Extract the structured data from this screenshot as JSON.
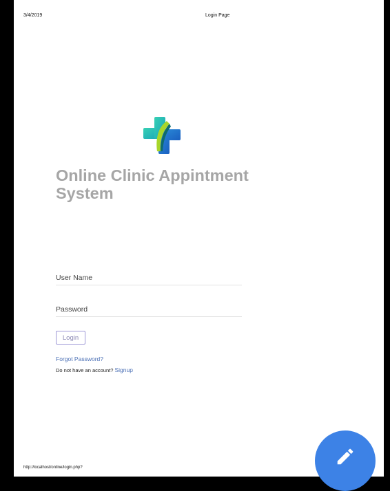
{
  "print_header": {
    "date": "3/4/2019",
    "title": "Login Page"
  },
  "app": {
    "title": "Online Clinic Appintment System",
    "logo_icon": "medical-cross-icon"
  },
  "login_form": {
    "username_placeholder": "User Name",
    "password_placeholder": "Password",
    "login_label": "Login",
    "forgot_label": "Forgot Password?",
    "no_account_text": "Do not have an account?",
    "signup_label": "Signup"
  },
  "print_footer": {
    "url": "http://localhost/online/login.php?"
  },
  "fab": {
    "icon": "pencil-icon",
    "color": "#3d82e6"
  }
}
